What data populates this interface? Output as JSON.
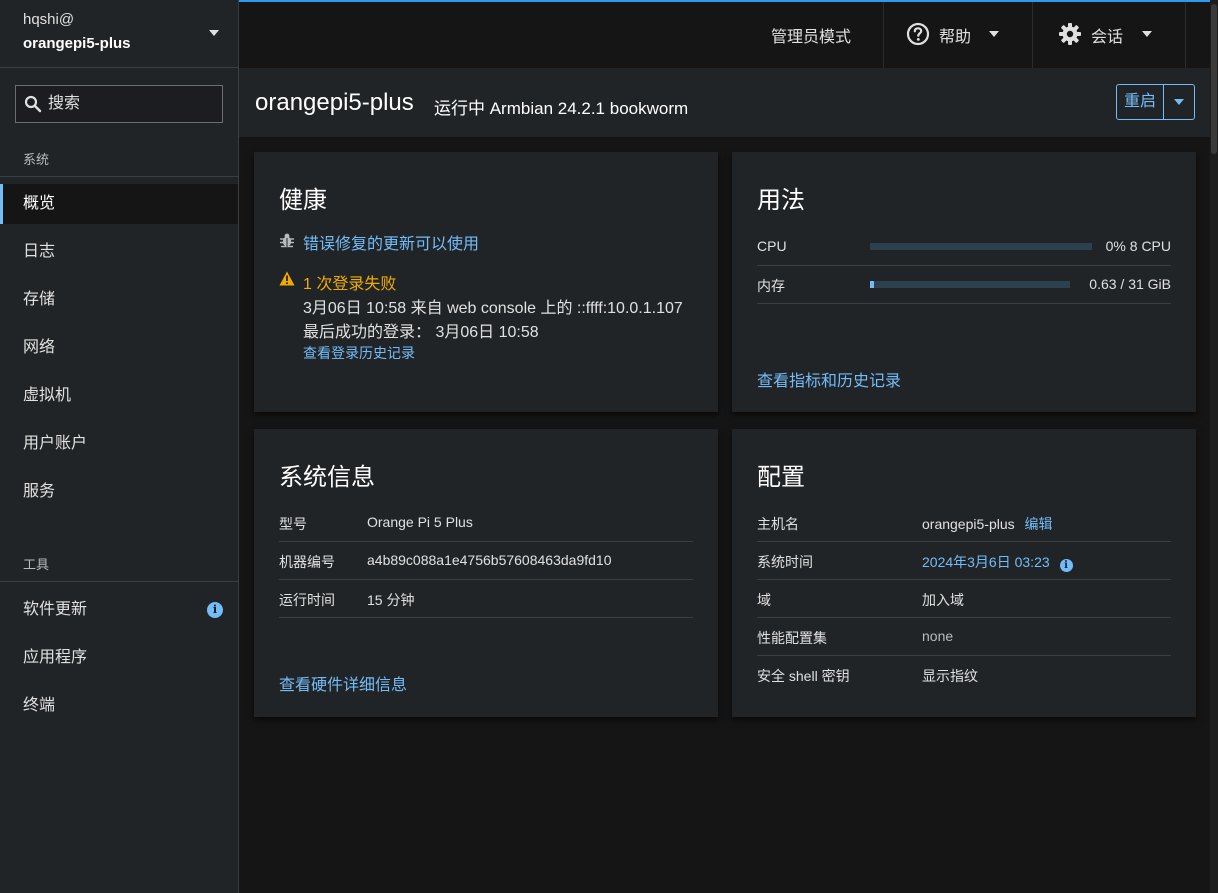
{
  "sidebar": {
    "user": "hqshi@",
    "host": "orangepi5-plus",
    "search_placeholder": "搜索",
    "section_system": "系统",
    "section_tools": "工具",
    "system_items": [
      {
        "label": "概览",
        "active": true
      },
      {
        "label": "日志"
      },
      {
        "label": "存储"
      },
      {
        "label": "网络"
      },
      {
        "label": "虚拟机"
      },
      {
        "label": "用户账户"
      },
      {
        "label": "服务"
      }
    ],
    "tool_items": [
      {
        "label": "软件更新",
        "badge": "i"
      },
      {
        "label": "应用程序"
      },
      {
        "label": "终端"
      }
    ]
  },
  "topbar": {
    "admin_mode": "管理员模式",
    "help": "帮助",
    "session": "会话"
  },
  "header": {
    "title": "orangepi5-plus",
    "subtitle": "运行中 Armbian 24.2.1 bookworm",
    "restart": "重启"
  },
  "health": {
    "title": "健康",
    "updates_link": "错误修复的更新可以使用",
    "failed_login": "1 次登录失败",
    "failed_detail": "3月06日 10:58 来自 web console 上的 ::ffff:10.0.1.107",
    "last_success": "最后成功的登录： 3月06日 10:58",
    "history_link": "查看登录历史记录"
  },
  "usage": {
    "title": "用法",
    "cpu_label": "CPU",
    "cpu_value": "0% 8 CPU",
    "cpu_fraction": 0.0,
    "mem_label": "内存",
    "mem_value": "0.63 / 31 GiB",
    "mem_fraction": 0.02,
    "metrics_link": "查看指标和历史记录"
  },
  "sysinfo": {
    "title": "系统信息",
    "rows": [
      {
        "label": "型号",
        "value": "Orange Pi 5 Plus"
      },
      {
        "label": "机器编号",
        "value": "a4b89c088a1e4756b57608463da9fd10"
      },
      {
        "label": "运行时间",
        "value": "15 分钟"
      }
    ],
    "hardware_link": "查看硬件详细信息"
  },
  "config": {
    "title": "配置",
    "hostname_label": "主机名",
    "hostname_value": "orangepi5-plus",
    "hostname_edit": "编辑",
    "time_label": "系统时间",
    "time_value": "2024年3月6日 03:23",
    "domain_label": "域",
    "domain_value": "加入域",
    "profile_label": "性能配置集",
    "profile_value": "none",
    "ssh_label": "安全 shell 密钥",
    "ssh_value": "显示指纹"
  },
  "colors": {
    "accent": "#73bcf7",
    "warning": "#f0ab00",
    "background": "#151515",
    "card": "#212427"
  }
}
